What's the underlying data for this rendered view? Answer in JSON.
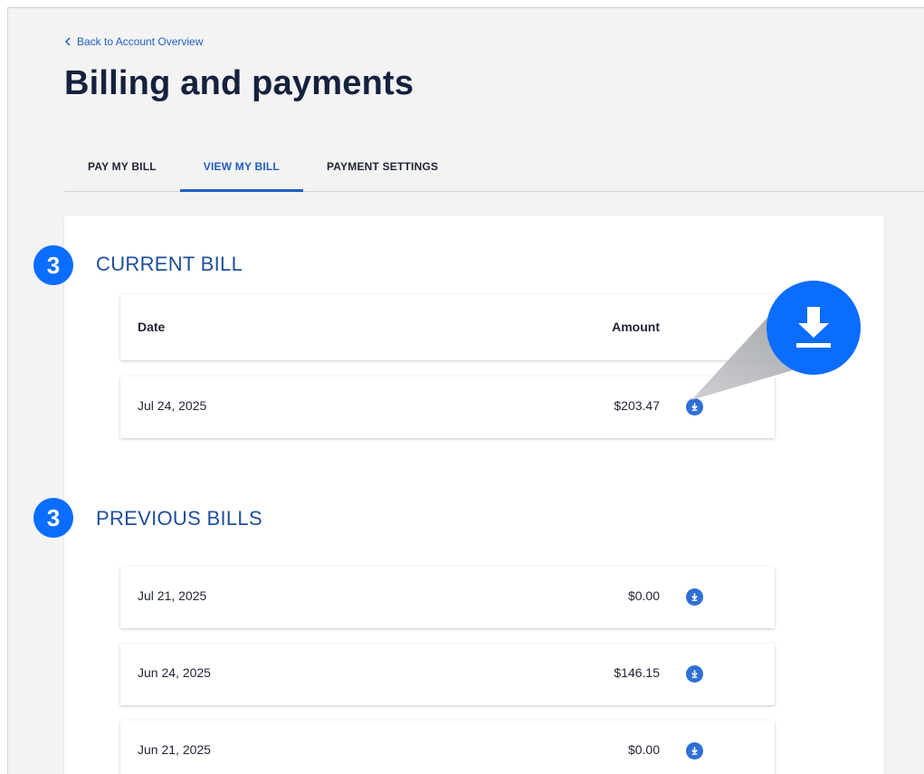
{
  "nav": {
    "back_label": "Back to Account Overview"
  },
  "page": {
    "title": "Billing and payments"
  },
  "tabs": [
    {
      "label": "PAY MY BILL",
      "active": false
    },
    {
      "label": "VIEW MY BILL",
      "active": true
    },
    {
      "label": "PAYMENT SETTINGS",
      "active": false
    }
  ],
  "current_bill": {
    "step_marker": "3",
    "title": "CURRENT BILL",
    "columns": {
      "date": "Date",
      "amount": "Amount"
    },
    "rows": [
      {
        "date": "Jul 24, 2025",
        "amount": "$203.47"
      }
    ]
  },
  "previous_bills": {
    "step_marker": "3",
    "title": "PREVIOUS BILLS",
    "rows": [
      {
        "date": "Jul 21, 2025",
        "amount": "$0.00"
      },
      {
        "date": "Jun 24, 2025",
        "amount": "$146.15"
      },
      {
        "date": "Jun 21, 2025",
        "amount": "$0.00"
      }
    ]
  },
  "icons": {
    "back": "chevron-left-icon",
    "download": "download-icon",
    "callout": "download-icon"
  },
  "colors": {
    "accent": "#1f5fbf",
    "title": "#15213d",
    "marker": "#0b6dff",
    "download_button": "#2f6fd6",
    "page_bg": "#f3f3f4"
  }
}
